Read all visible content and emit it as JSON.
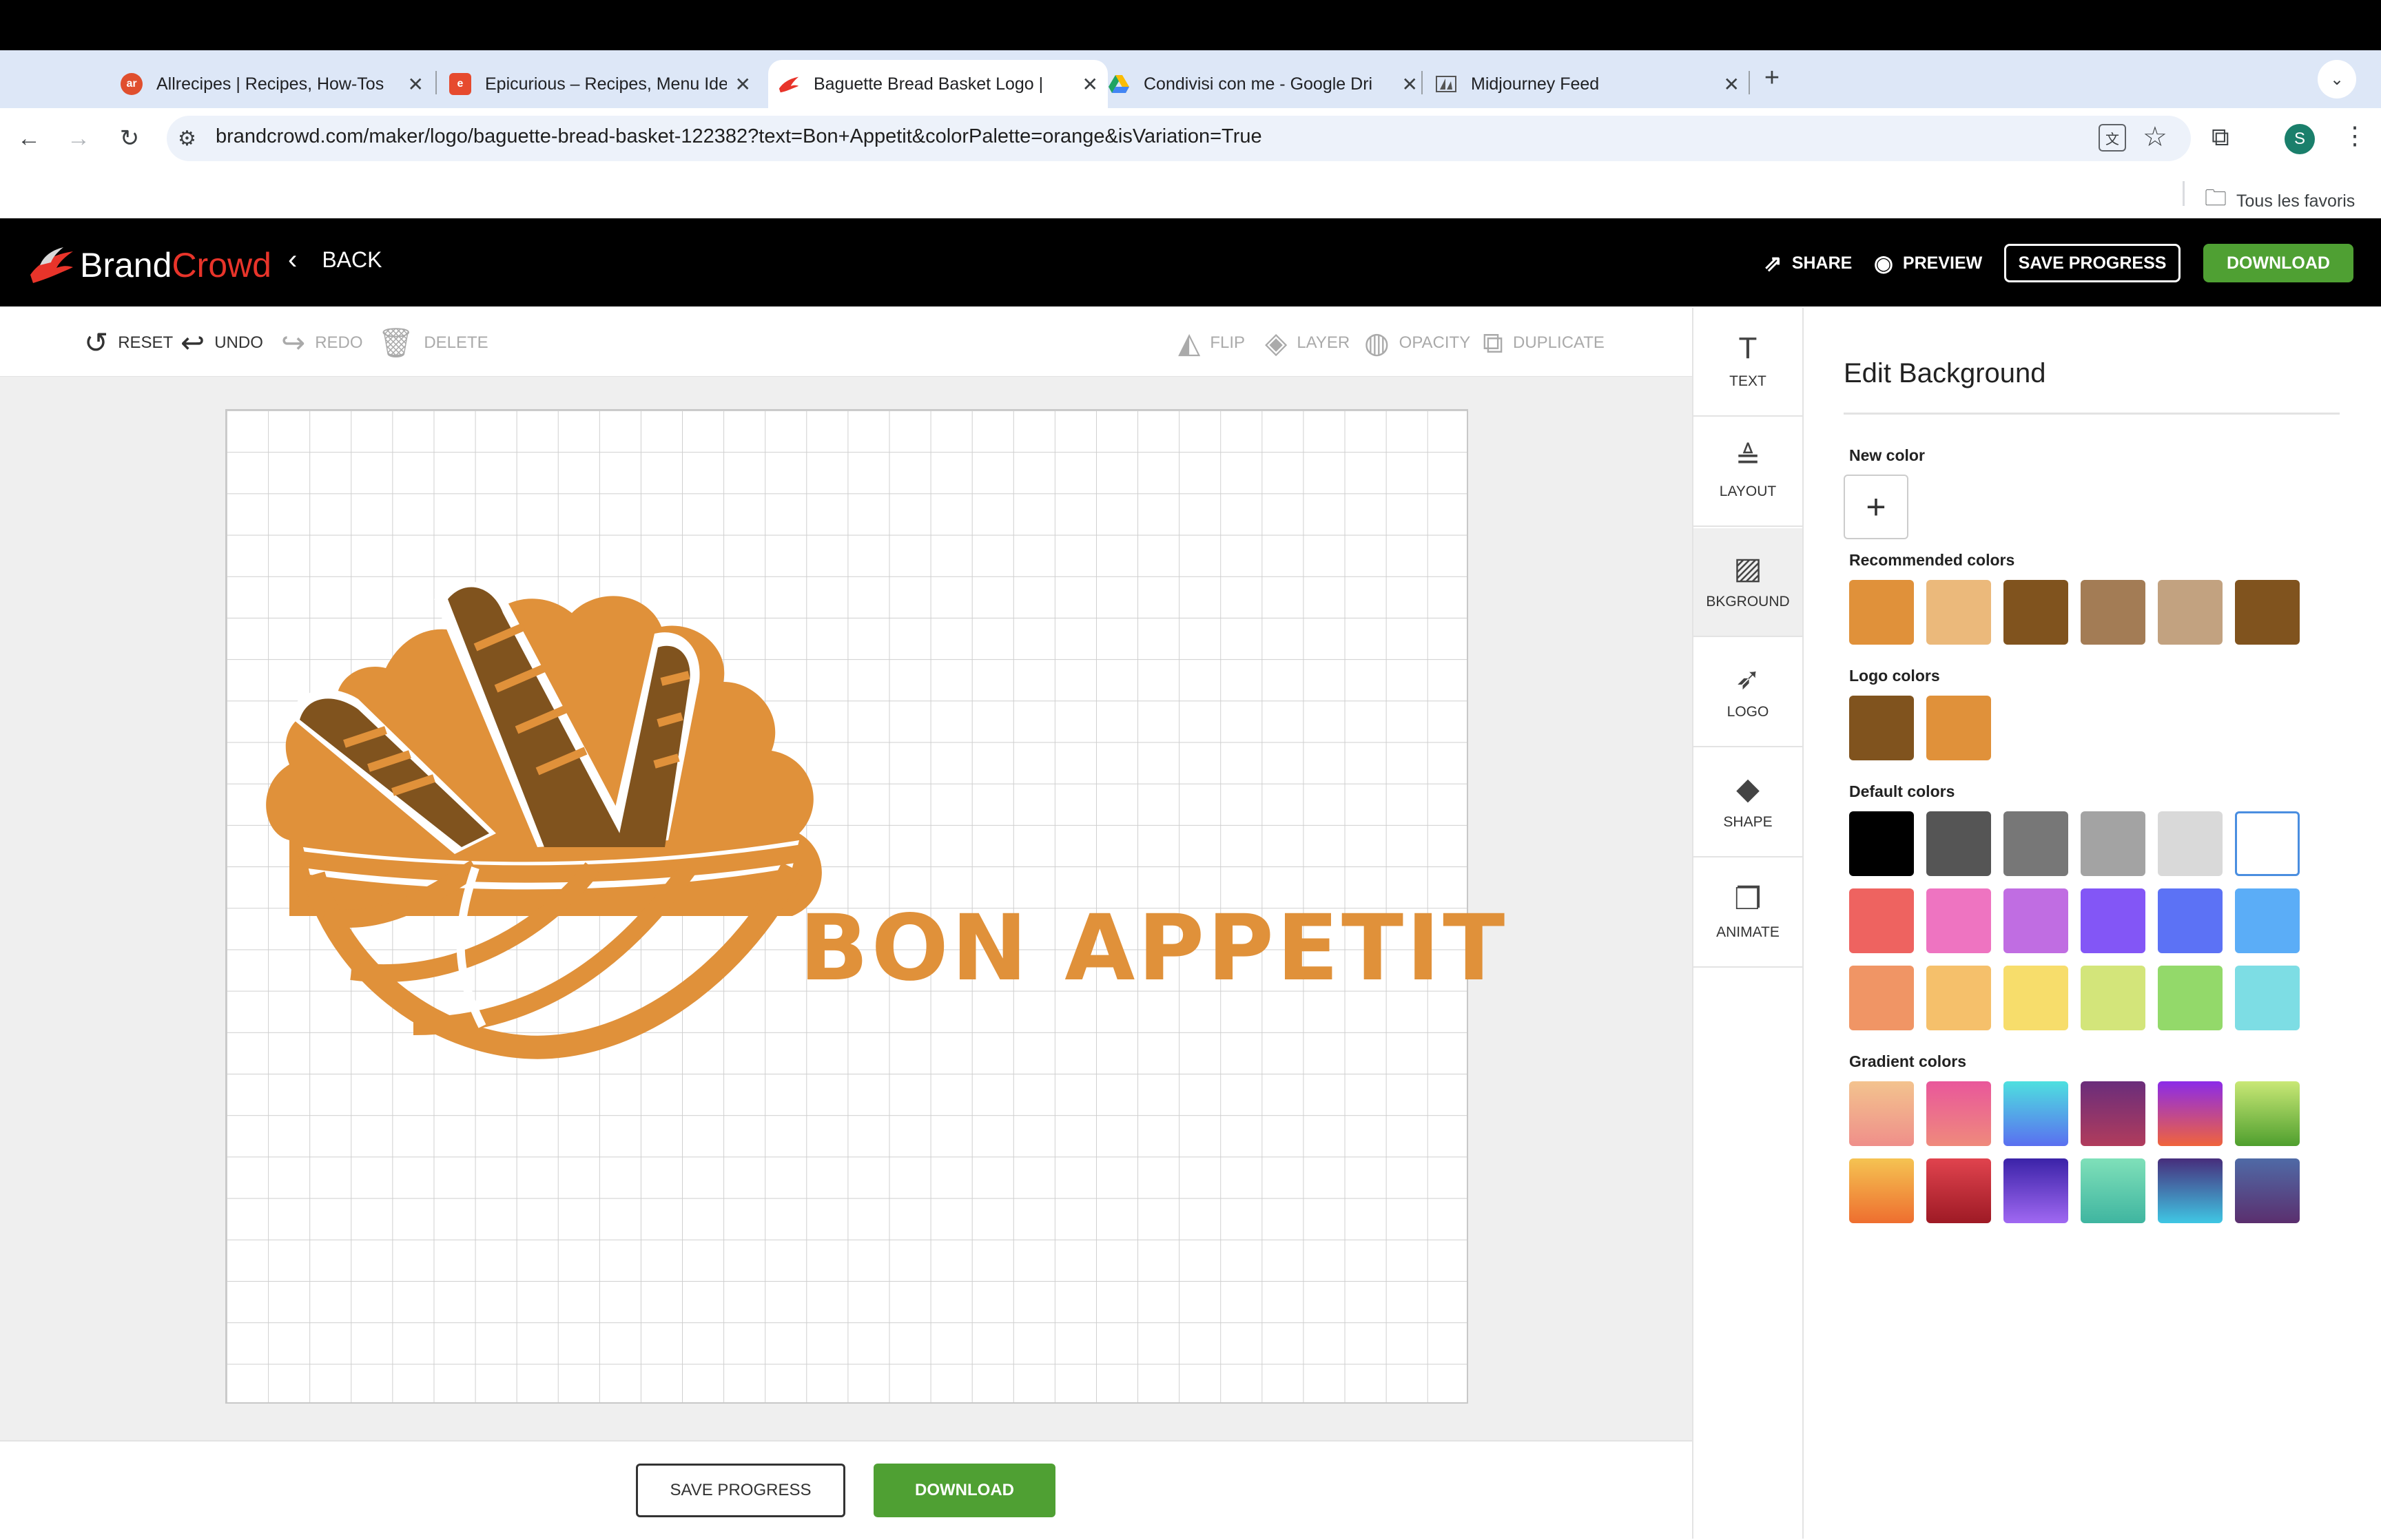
{
  "browser": {
    "tabs": [
      {
        "title": "Allrecipes | Recipes, How-Tos",
        "favicon": "allrecipes-favicon",
        "favicon_text": "ar",
        "favicon_color": "#e04f2e"
      },
      {
        "title": "Epicurious – Recipes, Menu Ide",
        "favicon": "epicurious-favicon",
        "favicon_text": "e",
        "favicon_color": "#e64a2e"
      },
      {
        "title": "Baguette Bread Basket Logo |",
        "favicon": "brandcrowd-favicon",
        "favicon_text": "",
        "favicon_color": "#e8342a"
      },
      {
        "title": "Condivisi con me - Google Dri",
        "favicon": "google-drive-favicon",
        "favicon_text": "",
        "favicon_color": "#1fa463"
      },
      {
        "title": "Midjourney Feed",
        "favicon": "midjourney-favicon",
        "favicon_text": "",
        "favicon_color": "#555555"
      }
    ],
    "new_tab": "+",
    "url": "brandcrowd.com/maker/logo/baguette-bread-basket-122382?text=Bon+Appetit&colorPalette=orange&isVariation=True",
    "profile_initial": "S",
    "bookmarks_label": "Tous les favoris"
  },
  "app": {
    "brand_part1": "Brand",
    "brand_part2": "Crowd",
    "back_label": "BACK",
    "share_label": "SHARE",
    "preview_label": "PREVIEW",
    "save_progress_label": "SAVE PROGRESS",
    "download_label": "DOWNLOAD"
  },
  "editor_toolbar": {
    "reset": "RESET",
    "undo": "UNDO",
    "redo": "REDO",
    "delete": "DELETE",
    "flip": "FLIP",
    "layer": "LAYER",
    "opacity": "OPACITY",
    "duplicate": "DUPLICATE"
  },
  "logo": {
    "text": "BON APPETIT",
    "primary_color": "#e0913a",
    "secondary_color": "#80531e"
  },
  "bottom": {
    "save_progress_label": "SAVE PROGRESS",
    "download_label": "DOWNLOAD"
  },
  "side_tools": [
    {
      "label": "TEXT",
      "icon": "text-icon"
    },
    {
      "label": "LAYOUT",
      "icon": "layout-icon"
    },
    {
      "label": "BKGROUND",
      "icon": "background-icon"
    },
    {
      "label": "LOGO",
      "icon": "logo-icon"
    },
    {
      "label": "SHAPE",
      "icon": "shape-icon"
    },
    {
      "label": "ANIMATE",
      "icon": "animate-icon"
    }
  ],
  "panel": {
    "title": "Edit Background",
    "new_color_label": "New color",
    "recommended_label": "Recommended colors",
    "logo_colors_label": "Logo colors",
    "default_label": "Default colors",
    "gradient_label": "Gradient colors",
    "recommended_colors": [
      "#e0913a",
      "#ebb97b",
      "#80531e",
      "#a37c55",
      "#c2a280",
      "#80531e"
    ],
    "logo_colors": [
      "#80531e",
      "#e0913a"
    ],
    "default_colors": [
      "#000000",
      "#555555",
      "#777777",
      "#a3a3a3",
      "#d9d9d9",
      "#ffffff",
      "#ee6360",
      "#ee74c1",
      "#c06de2",
      "#8356f6",
      "#5c72f5",
      "#5badf7",
      "#f09565",
      "#f5c06b",
      "#f7dd6b",
      "#d3e57a",
      "#93d96a",
      "#7ddde4"
    ],
    "gradient_colors": [
      [
        "#f3c38e",
        "#ef8f8a"
      ],
      [
        "#e9579b",
        "#ef8a7c"
      ],
      [
        "#4ee0df",
        "#5a6ff0"
      ],
      [
        "#6a2d7b",
        "#b13c5c"
      ],
      [
        "#8b2be8",
        "#f0643c"
      ],
      [
        "#c9e876",
        "#4f9f2e"
      ],
      [
        "#f5c352",
        "#ee6e2f"
      ],
      [
        "#e0434e",
        "#9e1a25"
      ],
      [
        "#3b23a8",
        "#a068f2"
      ],
      [
        "#7fe0b9",
        "#3fb5a0"
      ],
      [
        "#472d7c",
        "#3fc7e4"
      ],
      [
        "#4f6aa6",
        "#5b2f6e"
      ]
    ]
  }
}
